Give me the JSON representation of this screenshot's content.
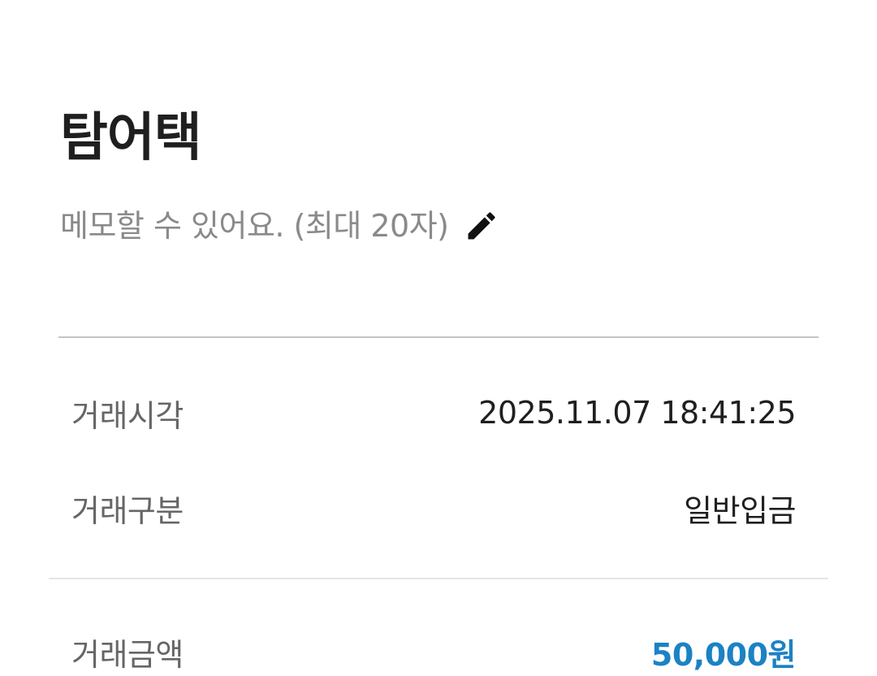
{
  "header": {
    "title": "탐어택",
    "memo_placeholder": "메모할 수 있어요. (최대 20자)",
    "edit_icon": "pencil-icon"
  },
  "details": {
    "time_label": "거래시각",
    "time_value": "2025.11.07 18:41:25",
    "type_label": "거래구분",
    "type_value": "일반입금",
    "amount_label": "거래금액",
    "amount_value": "50,000원"
  },
  "colors": {
    "amount": "#1b82c4",
    "label": "#666666",
    "placeholder": "#8a8a8a"
  }
}
